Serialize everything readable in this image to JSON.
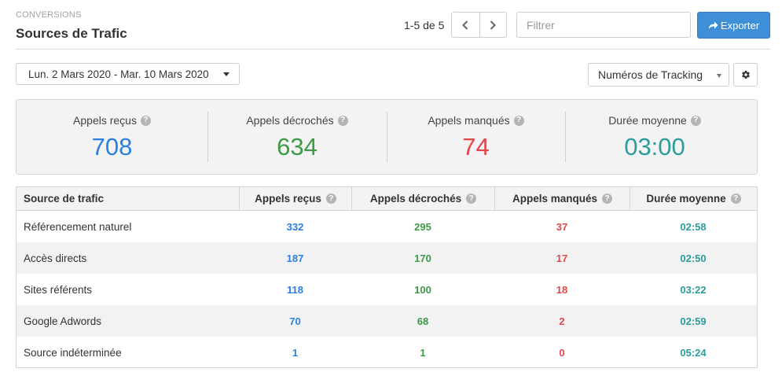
{
  "header": {
    "eyebrow": "CONVERSIONS",
    "title": "Sources de Trafic",
    "pager_text": "1-5 de 5",
    "filter_placeholder": "Filtrer",
    "export_label": "Exporter"
  },
  "toolbar": {
    "date_range": "Lun. 2 Mars 2020 - Mar. 10 Mars 2020",
    "tracking_select": "Numéros de Tracking"
  },
  "colors": {
    "received": "#2a7fe0",
    "answered": "#3e9a45",
    "missed": "#e2464a",
    "duration": "#2d9c9c"
  },
  "stats": [
    {
      "label": "Appels reçus",
      "value": "708",
      "color": "#2a7fe0"
    },
    {
      "label": "Appels décrochés",
      "value": "634",
      "color": "#3e9a45"
    },
    {
      "label": "Appels manqués",
      "value": "74",
      "color": "#e2464a"
    },
    {
      "label": "Durée moyenne",
      "value": "03:00",
      "color": "#2d9c9c"
    }
  ],
  "table": {
    "columns": [
      "Source de trafic",
      "Appels reçus",
      "Appels décrochés",
      "Appels manqués",
      "Durée moyenne"
    ],
    "rows": [
      {
        "source": "Référencement naturel",
        "received": "332",
        "answered": "295",
        "missed": "37",
        "duration": "02:58"
      },
      {
        "source": "Accès directs",
        "received": "187",
        "answered": "170",
        "missed": "17",
        "duration": "02:50"
      },
      {
        "source": "Sites référents",
        "received": "118",
        "answered": "100",
        "missed": "18",
        "duration": "03:22"
      },
      {
        "source": "Google Adwords",
        "received": "70",
        "answered": "68",
        "missed": "2",
        "duration": "02:59"
      },
      {
        "source": "Source indéterminée",
        "received": "1",
        "answered": "1",
        "missed": "0",
        "duration": "05:24"
      }
    ]
  },
  "icons": {
    "help": "help-icon",
    "prev": "chevron-left-icon",
    "next": "chevron-right-icon",
    "export": "share-arrow-icon",
    "settings": "gear-icon"
  }
}
